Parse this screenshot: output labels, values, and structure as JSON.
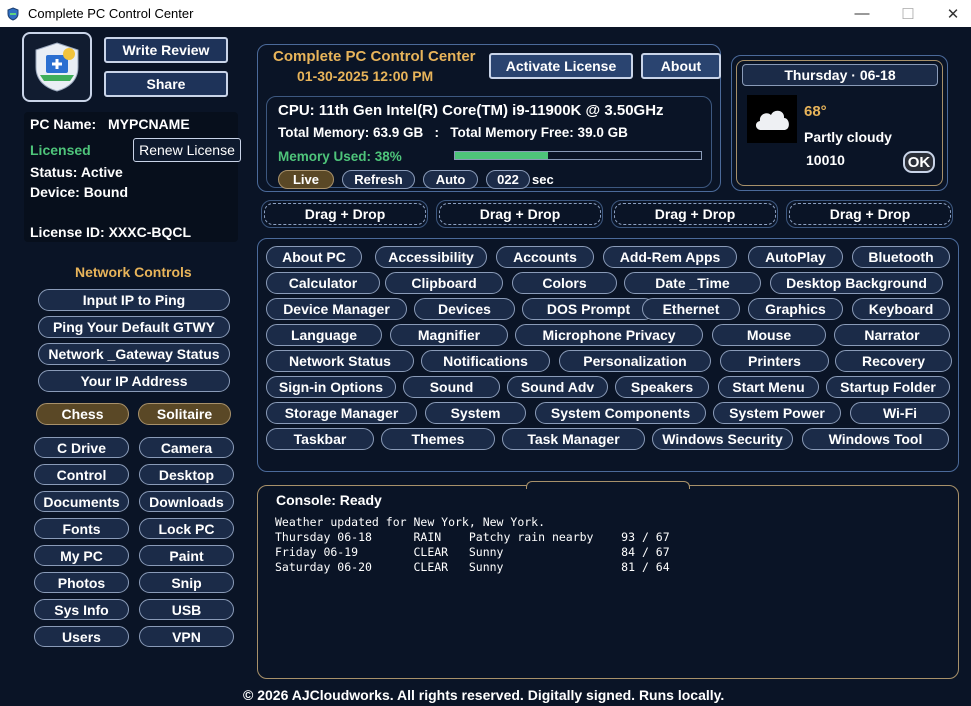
{
  "window": {
    "title": "Complete PC Control Center",
    "minimize": "—",
    "maximize": "☐",
    "close": "✕"
  },
  "left": {
    "write_review": "Write Review",
    "share": "Share",
    "pc_name_label": "PC Name:",
    "pc_name": "MYPCNAME",
    "licensed": "Licensed",
    "renew": "Renew License",
    "status": "Status: Active",
    "device": "Device: Bound",
    "license_id": "License ID: XXXC-BQCL",
    "network_title": "Network Controls",
    "network": [
      "Input IP to Ping",
      "Ping Your Default GTWY",
      "Network _Gateway Status",
      "Your IP Address"
    ],
    "games": [
      "Chess",
      "Solitaire"
    ],
    "shortcuts": [
      "C Drive",
      "Camera",
      "Control",
      "Desktop",
      "Documents",
      "Downloads",
      "Fonts",
      "Lock PC",
      "My PC",
      "Paint",
      "Photos",
      "Snip",
      "Sys Info",
      "USB",
      "Users",
      "VPN"
    ]
  },
  "header": {
    "app_name": "Complete PC Control Center",
    "datetime": "01-30-2025  12:00 PM",
    "activate": "Activate License",
    "about": "About"
  },
  "system": {
    "cpu": "CPU: 11th Gen Intel(R) Core(TM) i9-11900K @ 3.50GHz",
    "memory": "Total Memory: 63.9 GB   :   Total Memory Free: 39.0 GB",
    "memory_used": "Memory Used: 38%",
    "memory_used_pct": 38,
    "live": "Live",
    "refresh": "Refresh",
    "auto": "Auto",
    "interval": "022",
    "sec": "sec"
  },
  "weather": {
    "day": "Thursday · 06-18",
    "temp": "68°",
    "condition": "Partly cloudy",
    "zip": "10010",
    "ok": "OK",
    "icon": "cloud-icon"
  },
  "drag_drop": [
    "Drag + Drop",
    "Drag + Drop",
    "Drag + Drop",
    "Drag + Drop"
  ],
  "categories": [
    [
      "About PC",
      "Accessibility",
      "Accounts",
      "Add-Rem Apps",
      "AutoPlay",
      "Bluetooth"
    ],
    [
      "Calculator",
      "Clipboard",
      "Colors",
      "Date _Time",
      "Desktop Background"
    ],
    [
      "Device Manager",
      "Devices",
      "DOS Prompt",
      "Ethernet",
      "Graphics",
      "Keyboard"
    ],
    [
      "Language",
      "Magnifier",
      "Microphone Privacy",
      "Mouse",
      "Narrator"
    ],
    [
      "Network Status",
      "Notifications",
      "Personalization",
      "Printers",
      "Recovery"
    ],
    [
      "Sign-in Options",
      "Sound",
      "Sound Adv",
      "Speakers",
      "Start Menu",
      "Startup Folder"
    ],
    [
      "Storage Manager",
      "System",
      "System Components",
      "System Power",
      "Wi-Fi"
    ],
    [
      "Taskbar",
      "Themes",
      "Task Manager",
      "Windows Security",
      "Windows Tool"
    ]
  ],
  "console": {
    "title": "Console: Ready",
    "lines": [
      "Weather updated for New York, New York.",
      "Thursday 06-18      RAIN    Patchy rain nearby    93 / 67",
      "Friday 06-19        CLEAR   Sunny                 84 / 67",
      "Saturday 06-20      CLEAR   Sunny                 81 / 64"
    ]
  },
  "footer": "© 2026 AJCloudworks. All rights reserved.  Digitally signed. Runs locally.",
  "colors": {
    "background": "#0a1426",
    "gold": "#e8b45a",
    "licensed_green": "#4ec47a",
    "progress": "#4ec47a"
  }
}
